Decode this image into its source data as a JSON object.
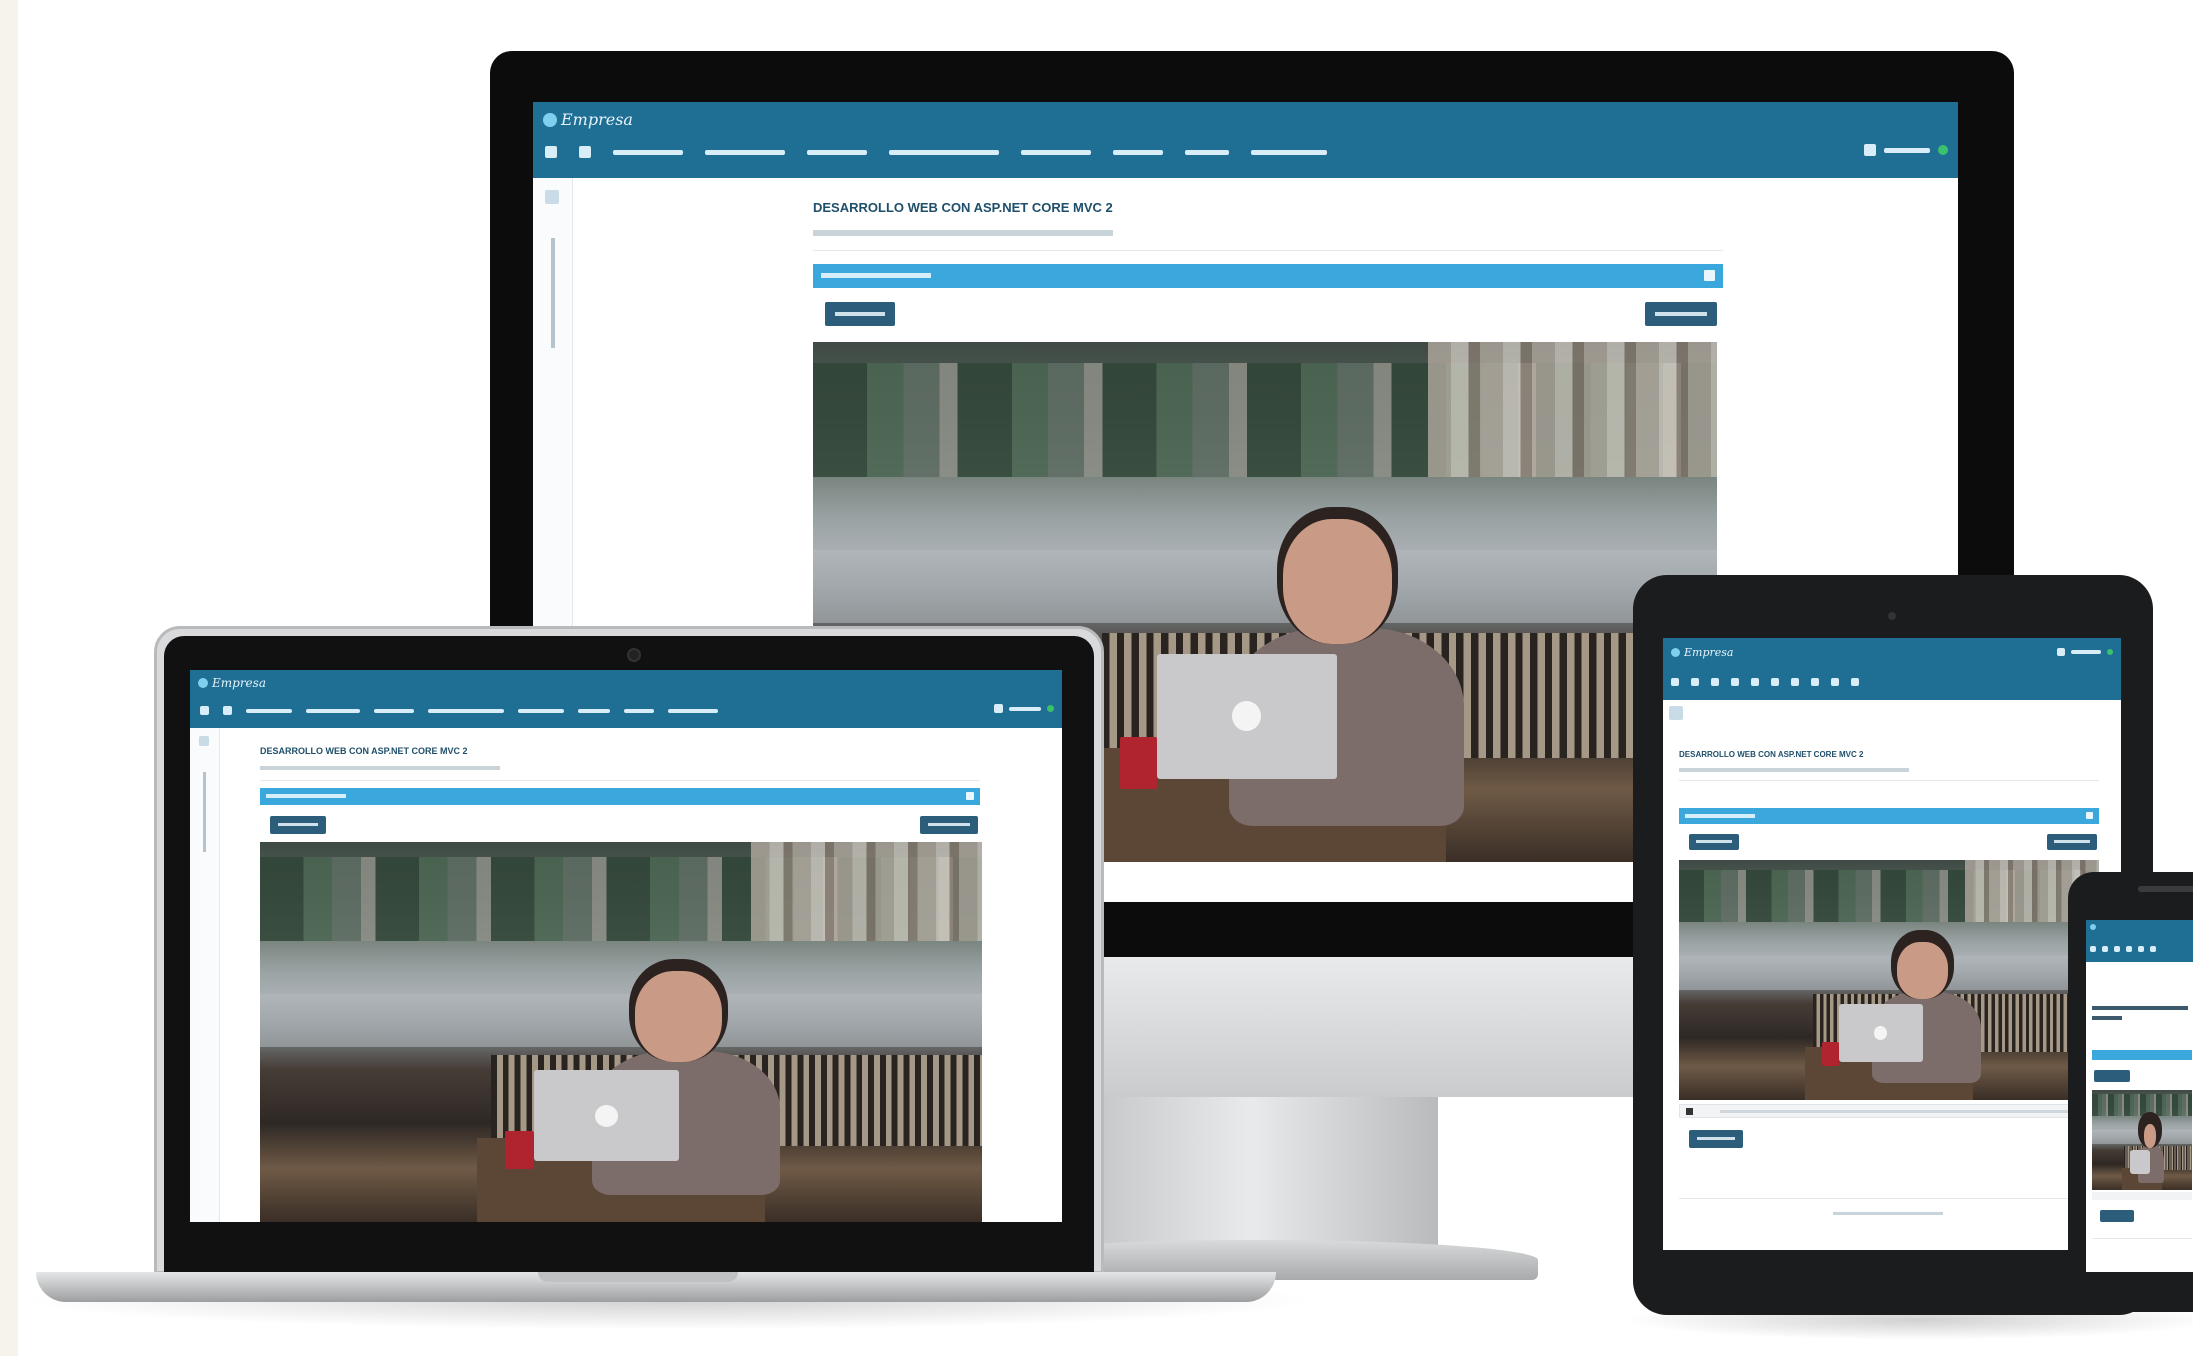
{
  "scene": {
    "description_title": "",
    "colors": {
      "header": "#1f6e94",
      "accent_bar": "#3aa7dd",
      "button": "#2c5d7a",
      "background": "#ffffff"
    }
  },
  "app": {
    "brand": "Empresa",
    "course_title": "DESARROLLO WEB CON ASP.NET CORE MVC 2",
    "nav_items": [
      "",
      "",
      "",
      "",
      "",
      "",
      "",
      "",
      "",
      ""
    ],
    "icons": [
      "home-icon",
      "tools-icon",
      "edit-icon",
      "settings-icon",
      "search-icon",
      "document-icon",
      "gear-icon",
      "share-icon",
      "flag-icon",
      "help-icon"
    ]
  }
}
